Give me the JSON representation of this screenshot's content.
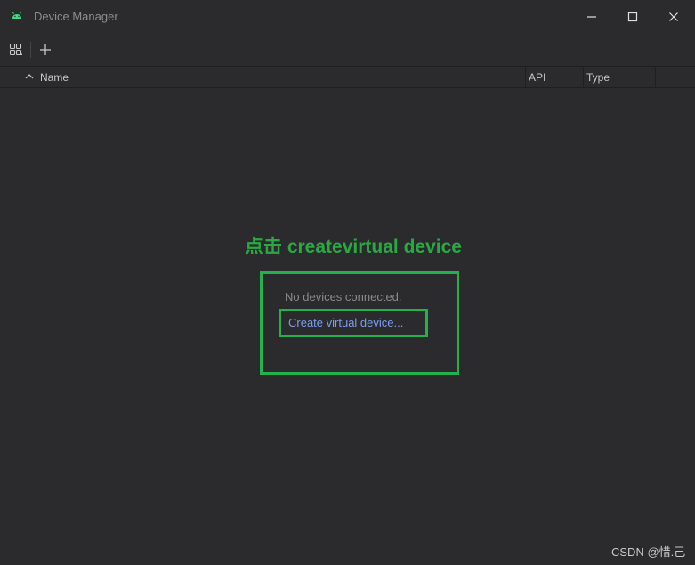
{
  "window": {
    "title": "Device Manager",
    "icon": "android-icon",
    "accent": "#3ddc84"
  },
  "toolbar": {
    "devices_icon": "device-grid-icon",
    "add_icon": "plus-icon"
  },
  "table": {
    "columns": [
      "Name",
      "API",
      "Type"
    ],
    "sort_icon": "chevron-up-icon"
  },
  "empty_state": {
    "message": "No devices connected.",
    "create_link": "Create virtual device..."
  },
  "annotation": {
    "text": "点击 createvirtual device",
    "color": "#22b14c"
  },
  "watermark": {
    "text": "CSDN @惜.己"
  }
}
